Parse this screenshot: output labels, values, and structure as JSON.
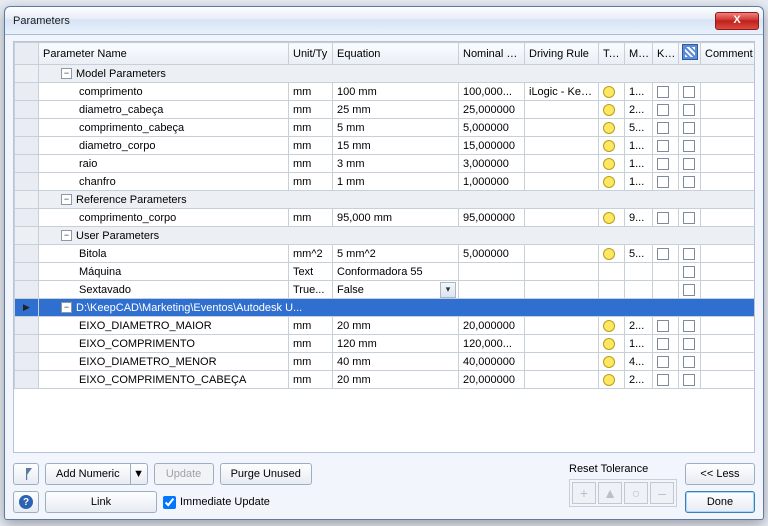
{
  "window": {
    "title": "Parameters",
    "close_label": "X"
  },
  "columns": {
    "name": "Parameter Name",
    "unit": "Unit/Ty",
    "eq": "Equation",
    "nom": "Nominal Val",
    "drv": "Driving Rule",
    "tol": "Tol.",
    "moc": "Moc",
    "key": "Key",
    "comment": "Comment"
  },
  "groups": {
    "model": "Model Parameters",
    "reference": "Reference Parameters",
    "user": "User Parameters",
    "linked": "D:\\KeepCAD\\Marketing\\Eventos\\Autodesk U..."
  },
  "rows": {
    "model": [
      {
        "name": "comprimento",
        "unit": "mm",
        "eq": "100 mm",
        "nom": "100,000...",
        "drv": "iLogic - Keep...",
        "tol": true,
        "moc": "1...",
        "key": true,
        "chk": true
      },
      {
        "name": "diametro_cabeça",
        "unit": "mm",
        "eq": "25 mm",
        "nom": "25,000000",
        "drv": "",
        "tol": true,
        "moc": "2...",
        "key": true,
        "chk": true
      },
      {
        "name": "comprimento_cabeça",
        "unit": "mm",
        "eq": "5 mm",
        "nom": "5,000000",
        "drv": "",
        "tol": true,
        "moc": "5...",
        "key": true,
        "chk": true
      },
      {
        "name": "diametro_corpo",
        "unit": "mm",
        "eq": "15 mm",
        "nom": "15,000000",
        "drv": "",
        "tol": true,
        "moc": "1...",
        "key": true,
        "chk": true
      },
      {
        "name": "raio",
        "unit": "mm",
        "eq": "3 mm",
        "nom": "3,000000",
        "drv": "",
        "tol": true,
        "moc": "1...",
        "key": true,
        "chk": true
      },
      {
        "name": "chanfro",
        "unit": "mm",
        "eq": "1 mm",
        "nom": "1,000000",
        "drv": "",
        "tol": true,
        "moc": "1...",
        "key": true,
        "chk": true
      }
    ],
    "reference": [
      {
        "name": "comprimento_corpo",
        "unit": "mm",
        "eq": "95,000 mm",
        "nom": "95,000000",
        "drv": "",
        "tol": true,
        "moc": "9...",
        "key": true,
        "chk": true
      }
    ],
    "user": [
      {
        "name": "Bitola",
        "unit": "mm^2",
        "eq": "5 mm^2",
        "nom": "5,000000",
        "drv": "",
        "tol": true,
        "moc": "5...",
        "key": true,
        "chk": true
      },
      {
        "name": "Máquina",
        "unit": "Text",
        "eq": "Conformadora 55",
        "nom": "",
        "drv": "",
        "tol": false,
        "moc": "",
        "key": false,
        "chk": true
      },
      {
        "name": "Sextavado",
        "unit": "True...",
        "eq": "False",
        "nom": "",
        "drv": "",
        "tol": false,
        "moc": "",
        "key": false,
        "chk": true,
        "dropdown": true
      }
    ],
    "linked": [
      {
        "name": "EIXO_DIAMETRO_MAIOR",
        "unit": "mm",
        "eq": "20 mm",
        "nom": "20,000000",
        "drv": "",
        "tol": true,
        "moc": "2...",
        "key": true,
        "chk": true
      },
      {
        "name": "EIXO_COMPRIMENTO",
        "unit": "mm",
        "eq": "120 mm",
        "nom": "120,000...",
        "drv": "",
        "tol": true,
        "moc": "1...",
        "key": true,
        "chk": true
      },
      {
        "name": "EIXO_DIAMETRO_MENOR",
        "unit": "mm",
        "eq": "40 mm",
        "nom": "40,000000",
        "drv": "",
        "tol": true,
        "moc": "4...",
        "key": true,
        "chk": true
      },
      {
        "name": "EIXO_COMPRIMENTO_CABEÇA",
        "unit": "mm",
        "eq": "20 mm",
        "nom": "20,000000",
        "drv": "",
        "tol": true,
        "moc": "2...",
        "key": true,
        "chk": true
      }
    ]
  },
  "footer": {
    "add_numeric": "Add Numeric",
    "update": "Update",
    "purge": "Purge Unused",
    "link": "Link",
    "immediate": "Immediate Update",
    "reset_tol": "Reset Tolerance",
    "less": "<< Less",
    "done": "Done",
    "tol_plus": "+",
    "tol_tri": "▲",
    "tol_circ": "○",
    "tol_minus": "–"
  }
}
